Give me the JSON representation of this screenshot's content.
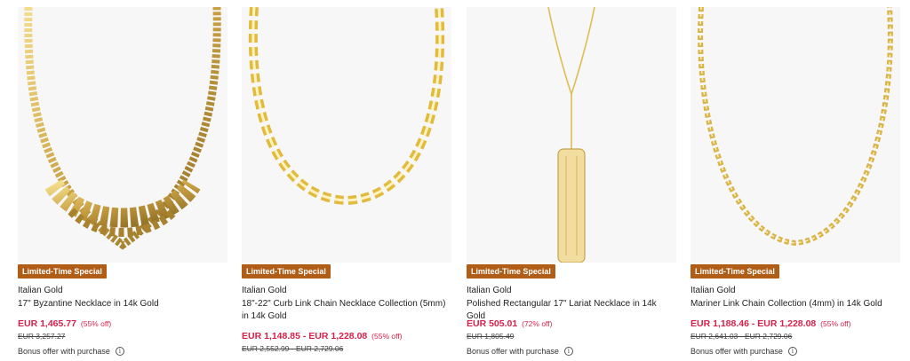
{
  "products": [
    {
      "badge": "Limited-Time Special",
      "brand": "Italian Gold",
      "title": "17\" Byzantine Necklace in 14k Gold",
      "price": "EUR 1,465.77",
      "discount": "(55% off)",
      "original_price": "EUR 3,257.27",
      "bonus": "Bonus offer with purchase",
      "image_icon": "byzantine-necklace-image"
    },
    {
      "badge": "Limited-Time Special",
      "brand": "Italian Gold",
      "title": "18\"-22\" Curb Link Chain Necklace Collection (5mm) in 14k Gold",
      "price": "EUR 1,148.85 - EUR 1,228.08",
      "discount": "(55% off)",
      "original_price": "EUR 2,552.99 - EUR 2,729.06",
      "bonus": "Bonus offer with purchase",
      "image_icon": "curb-chain-image"
    },
    {
      "badge": "Limited-Time Special",
      "brand": "Italian Gold",
      "title": "Polished Rectangular 17\" Lariat Necklace in 14k Gold",
      "price": "EUR 505.01",
      "discount": "(72% off)",
      "original_price": "EUR 1,805.49",
      "bonus": "Bonus offer with purchase",
      "image_icon": "lariat-necklace-image"
    },
    {
      "badge": "Limited-Time Special",
      "brand": "Italian Gold",
      "title": "Mariner Link Chain Collection (4mm) in 14k Gold",
      "price": "EUR 1,188.46 - EUR 1,228.08",
      "discount": "(55% off)",
      "original_price": "EUR 2,641.03 - EUR 2,729.06",
      "bonus": "Bonus offer with purchase",
      "image_icon": "mariner-chain-image"
    }
  ],
  "info_icon": "i",
  "colors": {
    "badge": "#b05d18",
    "price": "#d6224a",
    "gold": "#d9b44a"
  }
}
